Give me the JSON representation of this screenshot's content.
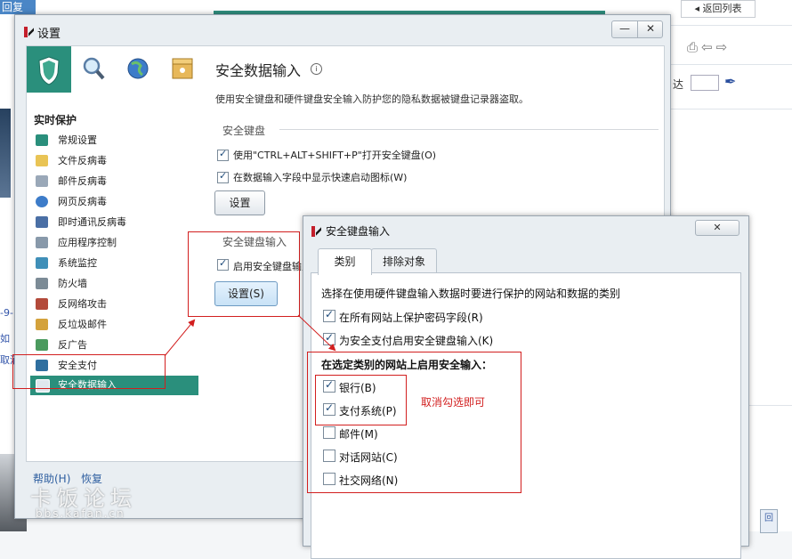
{
  "background": {
    "reply_label": "回复",
    "back_to_list": "返回列表",
    "tools_icons": [
      "print-icon",
      "arrow-left-icon",
      "arrow-right-icon"
    ],
    "da_label": "达",
    "left_snippets": [
      "-9-",
      "如",
      "取消"
    ],
    "scroll_label": "回"
  },
  "settings": {
    "title": "设置",
    "window_buttons": {
      "minimize": "—",
      "close": "✕"
    },
    "tabs": [
      "protection-tab",
      "scan-tab",
      "update-tab",
      "tools-tab"
    ],
    "sidebar": {
      "heading": "实时保护",
      "items": [
        {
          "label": "常规设置",
          "icon": "shield-icon",
          "color": "#2a8f7c"
        },
        {
          "label": "文件反病毒",
          "icon": "folder-icon",
          "color": "#e9c455"
        },
        {
          "label": "邮件反病毒",
          "icon": "mail-icon",
          "color": "#9aa8b8"
        },
        {
          "label": "网页反病毒",
          "icon": "globe-icon",
          "color": "#3d7cc9"
        },
        {
          "label": "即时通讯反病毒",
          "icon": "chat-icon",
          "color": "#4a6fa5"
        },
        {
          "label": "应用程序控制",
          "icon": "funnel-icon",
          "color": "#8899aa"
        },
        {
          "label": "系统监控",
          "icon": "monitor-icon",
          "color": "#3f8fb8"
        },
        {
          "label": "防火墙",
          "icon": "firewall-icon",
          "color": "#7c8b96"
        },
        {
          "label": "反网络攻击",
          "icon": "attack-icon",
          "color": "#b34a3a"
        },
        {
          "label": "反垃圾邮件",
          "icon": "spam-icon",
          "color": "#d4a23c"
        },
        {
          "label": "反广告",
          "icon": "ad-icon",
          "color": "#4b9a5e"
        },
        {
          "label": "安全支付",
          "icon": "payment-icon",
          "color": "#2f6f9f"
        },
        {
          "label": "安全数据输入",
          "icon": "keyboard-icon",
          "color": "#dfe8ee"
        }
      ]
    },
    "help_link": "帮助(H)",
    "restore_link": "恢复",
    "content": {
      "title": "安全数据输入",
      "description": "使用安全键盘和硬件键盘安全输入防护您的隐私数据被键盘记录器盗取。",
      "group1": {
        "label": "安全键盘",
        "options": [
          {
            "text": "使用\"CTRL+ALT+SHIFT+P\"打开安全键盘(O)",
            "checked": true
          },
          {
            "text": "在数据输入字段中显示快速启动图标(W)",
            "checked": true
          }
        ],
        "button": "设置"
      },
      "group2": {
        "label": "安全键盘输入",
        "options": [
          {
            "text": "启用安全键盘输入",
            "checked": true
          }
        ],
        "button": "设置(S)"
      }
    }
  },
  "dialog": {
    "title": "安全键盘输入",
    "close": "✕",
    "tabs": [
      "类别",
      "排除对象"
    ],
    "intro": "选择在使用硬件键盘输入数据时要进行保护的网站和数据的类别",
    "options_top": [
      {
        "text": "在所有网站上保护密码字段(R)",
        "checked": true
      },
      {
        "text": "为安全支付启用安全键盘输入(K)",
        "checked": true
      }
    ],
    "category_heading": "在选定类别的网站上启用安全输入：",
    "categories": [
      {
        "text": "银行(B)",
        "checked": true
      },
      {
        "text": "支付系统(P)",
        "checked": true
      },
      {
        "text": "邮件(M)",
        "checked": false
      },
      {
        "text": "对话网站(C)",
        "checked": false
      },
      {
        "text": "社交网络(N)",
        "checked": false
      }
    ]
  },
  "annotations": {
    "note": "取消勾选即可",
    "color": "#d21f1f"
  },
  "watermark": {
    "title": "卡饭论坛",
    "url": "bbs.kafan.cn"
  }
}
